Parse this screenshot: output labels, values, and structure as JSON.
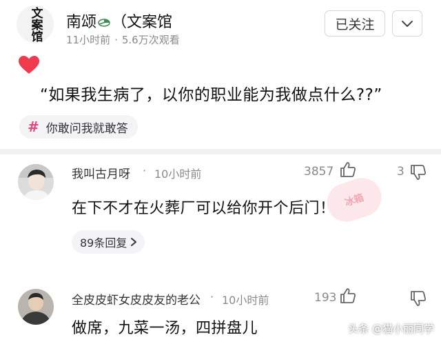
{
  "post": {
    "author": {
      "avatar_text": "文案馆",
      "name_prefix": "南颂",
      "name_suffix": "（文案馆",
      "time": "11小时前",
      "views": "5.6万次观看"
    },
    "follow_label": "已关注",
    "text": "“如果我生病了，以你的职业能为我做点什么??”",
    "topic": "你敢问我就敢答"
  },
  "comments": [
    {
      "user": "我叫古月呀",
      "time": "10小时前",
      "likes": "3857",
      "dislikes": "3",
      "text": "在下不才在火葬厂可以给你开个后门！",
      "replies": "89条回复",
      "stamp": "冰箱"
    },
    {
      "user": "全皮皮虾女皮皮友的老公",
      "time": "10小时前",
      "likes": "193",
      "text": "做席，九菜一汤，四拼盘儿"
    }
  ],
  "watermark": "头条 @猫小丽同学",
  "colors": {
    "accent": "#e8457b",
    "heart": "#f03b4e",
    "muted": "#8a8a8a"
  }
}
